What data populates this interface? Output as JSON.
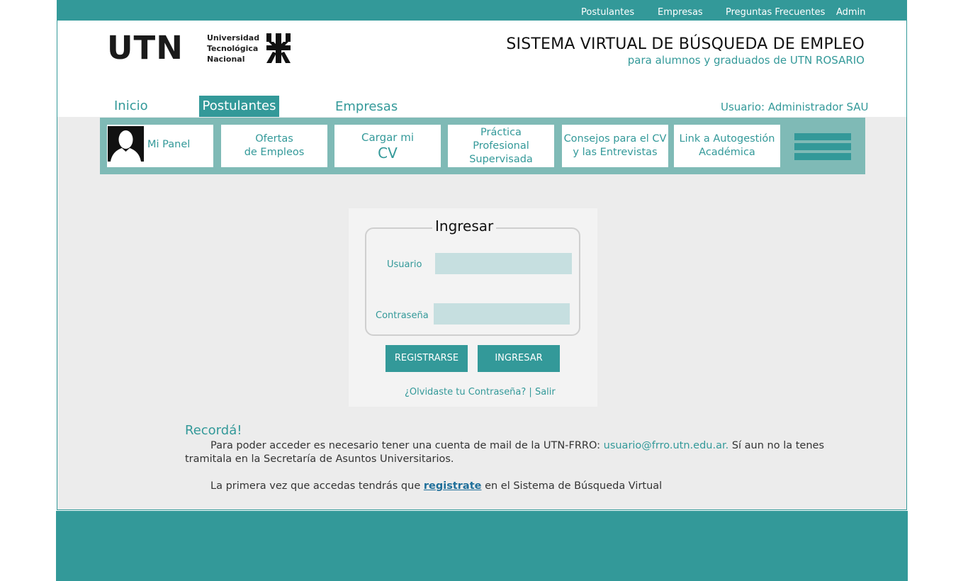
{
  "topnav": {
    "postulantes": "Postulantes",
    "empresas": "Empresas",
    "faq": "Preguntas Frecuentes",
    "admin": "Admin"
  },
  "logo": {
    "utn": "UTN",
    "line1": "Universidad",
    "line2": "Tecnológica",
    "line3": "Nacional"
  },
  "header": {
    "title": "SISTEMA VIRTUAL DE BÚSQUEDA DE EMPLEO",
    "subtitle": "para alumnos y graduados de UTN ROSARIO"
  },
  "mainnav": {
    "inicio": "Inicio",
    "postulantes": "Postulantes",
    "empresas": "Empresas",
    "user": "Usuario: Administrador SAU"
  },
  "menu": {
    "panel": "Mi Panel",
    "ofertas_l1": "Ofertas",
    "ofertas_l2": "de Empleos",
    "cargar_l1": "Cargar mi",
    "cargar_l2": "CV",
    "practica_l1": "Práctica",
    "practica_l2": "Profesional",
    "practica_l3": "Supervisada",
    "consejos_l1": "Consejos para el CV",
    "consejos_l2": "y las Entrevistas",
    "link_l1": "Link a Autogestión",
    "link_l2": "Académica"
  },
  "login": {
    "title": "Ingresar",
    "user_label": "Usuario",
    "pass_label": "Contraseña",
    "user_value": "",
    "pass_value": "",
    "register_btn": "REGISTRARSE",
    "login_btn": "INGRESAR",
    "forgot": "¿Olvidaste tu Contraseña?",
    "sep": " | ",
    "exit": "Salir"
  },
  "reminder": {
    "title": "Recordá!",
    "p1_a": "Para poder acceder es necesario tener una cuenta de mail de la UTN-FRRO: ",
    "p1_mail": "usuario@frro.utn.edu.ar.",
    "p1_b": " Sí aun no la tenes",
    "p1_c": "tramitala en la Secretaría de Asuntos Universitarios.",
    "p2_a": "La primera vez que accedas tendrás que ",
    "p2_link": "registrate",
    "p2_b": " en el Sistema de Búsqueda Virtual"
  },
  "colors": {
    "accent": "#339999",
    "menu_bg": "#7fbab6",
    "input_bg": "#c6dfe0"
  },
  "icons": {
    "avatar": "user-silhouette-icon",
    "menu": "hamburger-menu-icon",
    "emblem": "utn-emblem-icon"
  }
}
